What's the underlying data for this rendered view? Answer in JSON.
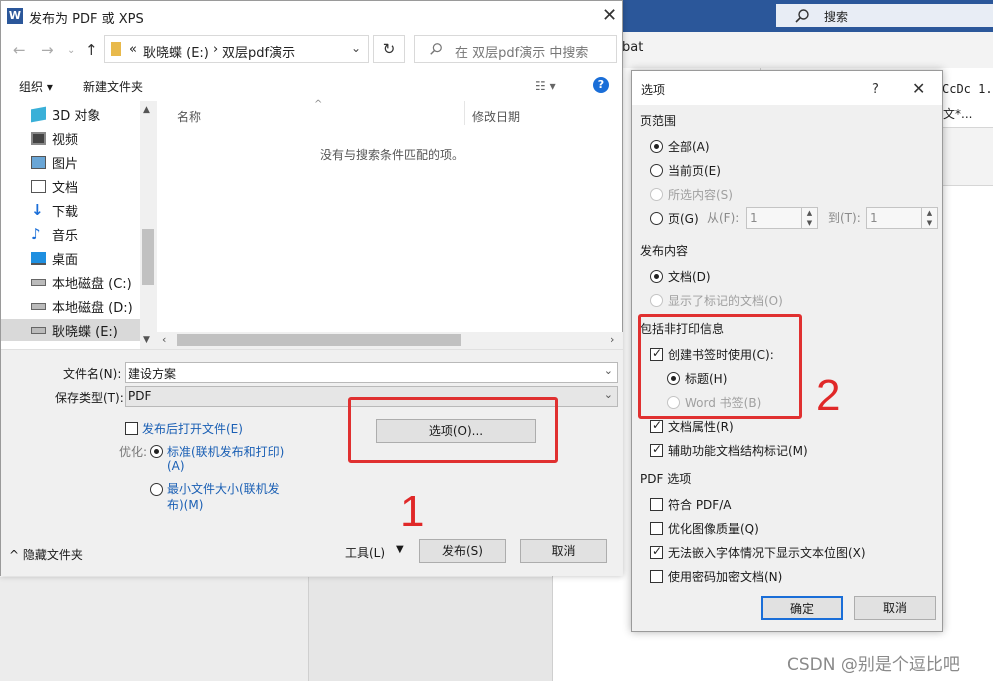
{
  "word_window": {
    "search_label": "搜索",
    "pdfmaker_tab": "bat",
    "style_preview": "CcDc 1.",
    "style_name": "文*..."
  },
  "save_dialog": {
    "title": "发布为 PDF 或 XPS",
    "address": {
      "crumbs": [
        "«",
        "耿晓蝶 (E:)",
        "›",
        "双层pdf演示"
      ]
    },
    "search_placeholder": "在 双层pdf演示 中搜索",
    "toolbar": {
      "organize": "组织 ▾",
      "new_folder": "新建文件夹"
    },
    "nav_items": [
      {
        "label": "3D 对象",
        "icon": "3d-objects-icon"
      },
      {
        "label": "视频",
        "icon": "video-icon"
      },
      {
        "label": "图片",
        "icon": "pictures-icon"
      },
      {
        "label": "文档",
        "icon": "documents-icon"
      },
      {
        "label": "下载",
        "icon": "download-icon"
      },
      {
        "label": "音乐",
        "icon": "music-icon"
      },
      {
        "label": "桌面",
        "icon": "desktop-icon"
      },
      {
        "label": "本地磁盘 (C:)",
        "icon": "drive-icon"
      },
      {
        "label": "本地磁盘 (D:)",
        "icon": "drive-icon"
      },
      {
        "label": "耿晓蝶 (E:)",
        "icon": "drive-icon",
        "selected": true
      }
    ],
    "columns": {
      "name": "名称",
      "date": "修改日期"
    },
    "empty_message": "没有与搜索条件匹配的项。",
    "filename_label": "文件名(N):",
    "filename_value": "建设方案",
    "filetype_label": "保存类型(T):",
    "filetype_value": "PDF",
    "open_after_label": "发布后打开文件(E)",
    "optimize_label": "优化:",
    "optimize_standard": [
      "标准(联机发布和打印)",
      "(A)"
    ],
    "optimize_min": [
      "最小文件大小(联机发",
      "布)(M)"
    ],
    "options_button": "选项(O)...",
    "tools_label": "工具(L)",
    "publish_button": "发布(S)",
    "cancel_button": "取消",
    "hide_folders": "隐藏文件夹",
    "annotation_1": "1"
  },
  "options_dialog": {
    "title": "选项",
    "help": "?",
    "page_range_header": "页范围",
    "all": "全部(A)",
    "current_page": "当前页(E)",
    "selection": "所选内容(S)",
    "pages": "页(G)",
    "from_label": "从(F):",
    "from_value": "1",
    "to_label": "到(T):",
    "to_value": "1",
    "publish_what_header": "发布内容",
    "document": "文档(D)",
    "doc_markup": "显示了标记的文档(O)",
    "nonprint_header": "包括非打印信息",
    "create_bookmarks": "创建书签时使用(C):",
    "headings": "标题(H)",
    "word_bookmarks": "Word 书签(B)",
    "doc_properties": "文档属性(R)",
    "doc_structure": "辅助功能文档结构标记(M)",
    "pdf_options_header": "PDF 选项",
    "pdfa": "符合 PDF/A",
    "optimize_image": "优化图像质量(Q)",
    "bitmap_text": "无法嵌入字体情况下显示文本位图(X)",
    "encrypt": "使用密码加密文档(N)",
    "ok": "确定",
    "cancel": "取消",
    "annotation_2": "2"
  },
  "watermark": "CSDN @别是个逗比吧"
}
